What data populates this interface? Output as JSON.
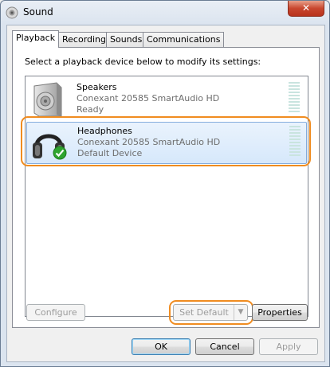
{
  "window": {
    "title": "Sound",
    "close_symbol": "✕"
  },
  "tabs": [
    {
      "label": "Playback",
      "active": true
    },
    {
      "label": "Recording",
      "active": false
    },
    {
      "label": "Sounds",
      "active": false
    },
    {
      "label": "Communications",
      "active": false
    }
  ],
  "playback": {
    "instruction": "Select a playback device below to modify its settings:",
    "devices": [
      {
        "name": "Speakers",
        "driver": "Conexant 20585 SmartAudio HD",
        "status": "Ready",
        "icon": "speaker-icon",
        "selected": false
      },
      {
        "name": "Headphones",
        "driver": "Conexant 20585 SmartAudio HD",
        "status": "Default Device",
        "icon": "headphones-icon",
        "selected": true,
        "badge": "default-check-icon"
      }
    ],
    "configure_label": "Configure",
    "set_default_label": "Set Default",
    "properties_label": "Properties"
  },
  "dialog_buttons": {
    "ok": "OK",
    "cancel": "Cancel",
    "apply": "Apply"
  },
  "colors": {
    "highlight_ring": "#f08c20",
    "selection": "#d6e8fb",
    "check": "#2fa52f",
    "meter": "#c9e4df"
  }
}
